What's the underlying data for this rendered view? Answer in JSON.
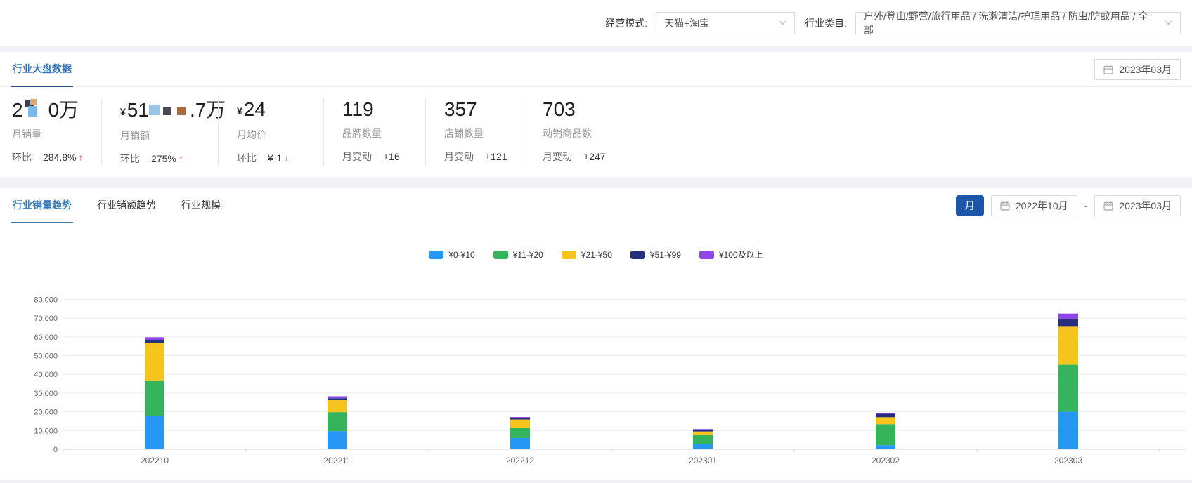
{
  "filters": {
    "business_mode": {
      "label": "经营模式:",
      "value": "天猫+淘宝"
    },
    "category": {
      "label": "行业类目:",
      "value": "户外/登山/野营/旅行用品 / 洗漱清洁/护理用品 / 防虫/防蚊用品 / 全部"
    }
  },
  "overview": {
    "tab": "行业大盘数据",
    "date": "2023年03月",
    "stats": [
      {
        "value_prefix": "2",
        "masked": true,
        "value_suffix": "0万",
        "label": "月销量",
        "sub_label": "环比",
        "sub_value": "284.8%",
        "trend": "up"
      },
      {
        "currency": "¥",
        "value_prefix": "51",
        "masked": true,
        "value_suffix": ".7万",
        "label": "月销额",
        "sub_label": "环比",
        "sub_value": "275%",
        "trend": "up"
      },
      {
        "currency": "¥",
        "value": "24",
        "label": "月均价",
        "sub_label": "环比",
        "sub_value": "¥-1",
        "trend": "down"
      },
      {
        "value": "119",
        "label": "品牌数量",
        "sub_label": "月变动",
        "sub_value": "+16",
        "trend": "none"
      },
      {
        "value": "357",
        "label": "店铺数量",
        "sub_label": "月变动",
        "sub_value": "+121",
        "trend": "none"
      },
      {
        "value": "703",
        "label": "动销商品数",
        "sub_label": "月变动",
        "sub_value": "+247",
        "trend": "none"
      }
    ]
  },
  "trend_section": {
    "tabs": [
      {
        "label": "行业销量趋势",
        "active": true
      },
      {
        "label": "行业销额趋势",
        "active": false
      },
      {
        "label": "行业规模",
        "active": false
      }
    ],
    "period_button": "月",
    "date_start": "2022年10月",
    "date_separator": "-",
    "date_end": "2023年03月"
  },
  "chart_data": {
    "type": "bar",
    "stacked": true,
    "categories": [
      "202210",
      "202211",
      "202212",
      "202301",
      "202302",
      "202303"
    ],
    "series": [
      {
        "name": "¥0-¥10",
        "color": "#2797f4",
        "values": [
          17800,
          9700,
          6000,
          3000,
          2200,
          20000
        ]
      },
      {
        "name": "¥11-¥20",
        "color": "#36b45c",
        "values": [
          19000,
          10100,
          5600,
          4500,
          11200,
          25100
        ]
      },
      {
        "name": "¥21-¥50",
        "color": "#f6c51d",
        "values": [
          20000,
          6400,
          4300,
          2000,
          3700,
          20300
        ]
      },
      {
        "name": "¥51-¥99",
        "color": "#242f7e",
        "values": [
          1500,
          1000,
          900,
          900,
          1800,
          4100
        ]
      },
      {
        "name": "¥100及以上",
        "color": "#8c46ea",
        "values": [
          1500,
          1100,
          400,
          400,
          500,
          2900
        ]
      }
    ],
    "title": "",
    "xlabel": "",
    "ylabel": "",
    "ylim": [
      0,
      80000
    ],
    "ytick_step": 10000,
    "grid": true,
    "legend_position": "top"
  },
  "colors": {
    "active_tab_text": "#3878b4",
    "overview_tab_underline": "#1d4e89",
    "month_button": "#1d55a8",
    "up_arrow": "#f0483e",
    "down_arrow": "#52c41a"
  }
}
